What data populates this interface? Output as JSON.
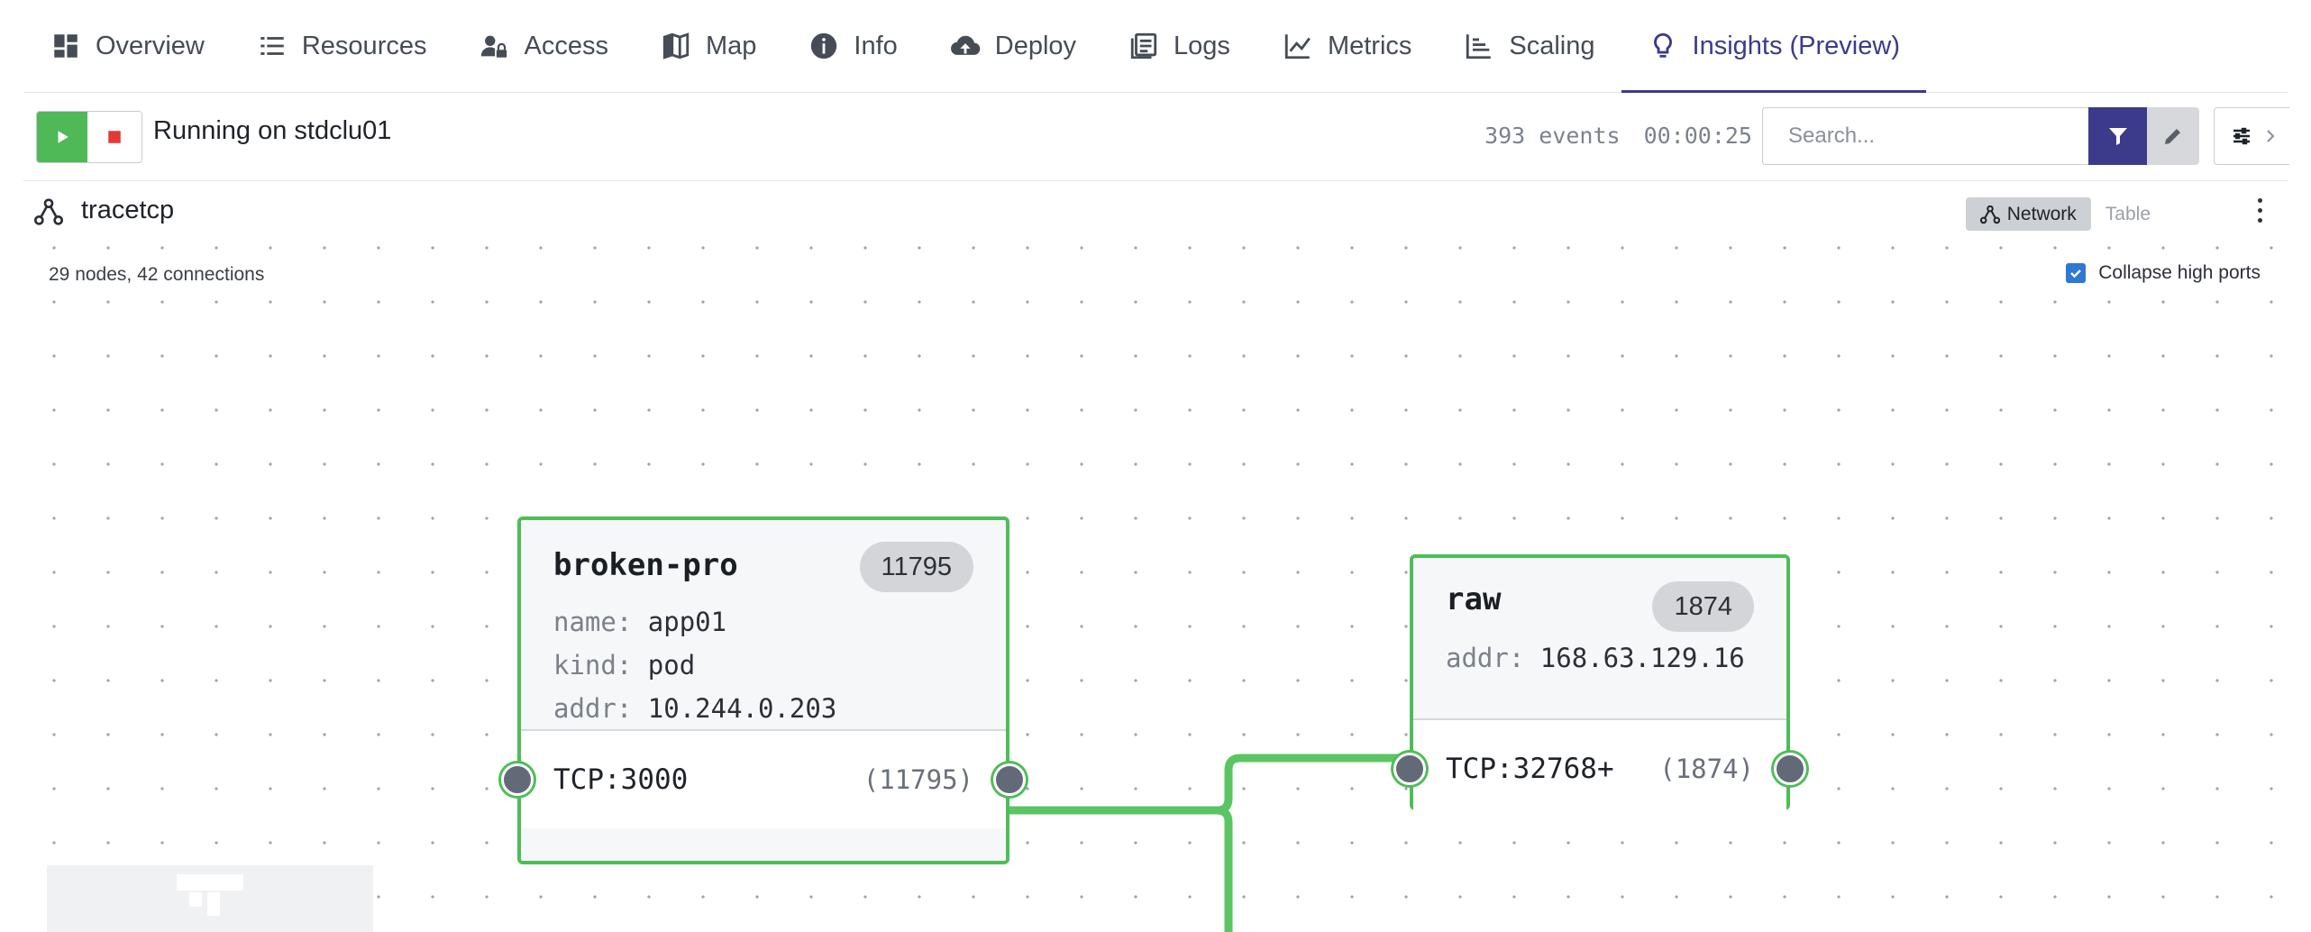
{
  "tabs": [
    {
      "label": "Overview",
      "icon": "dashboard-icon"
    },
    {
      "label": "Resources",
      "icon": "list-icon"
    },
    {
      "label": "Access",
      "icon": "user-lock-icon"
    },
    {
      "label": "Map",
      "icon": "map-icon"
    },
    {
      "label": "Info",
      "icon": "info-icon"
    },
    {
      "label": "Deploy",
      "icon": "cloud-upload-icon"
    },
    {
      "label": "Logs",
      "icon": "logs-icon"
    },
    {
      "label": "Metrics",
      "icon": "line-chart-icon"
    },
    {
      "label": "Scaling",
      "icon": "scaling-icon"
    },
    {
      "label": "Insights (Preview)",
      "icon": "lightbulb-icon",
      "active": true
    }
  ],
  "toolbar": {
    "status": "Running on stdclu01",
    "events": "393 events",
    "elapsed": "00:00:25",
    "search_placeholder": "Search..."
  },
  "panel": {
    "title": "tracetcp",
    "view_network": "Network",
    "view_table": "Table",
    "active_view": "Network"
  },
  "graph": {
    "stats": "29 nodes, 42 connections",
    "collapse_label": "Collapse high ports",
    "collapse_checked": true,
    "nodes": [
      {
        "name": "broken-pro",
        "count": "11795",
        "fields": [
          {
            "key": "name:",
            "value": "app01"
          },
          {
            "key": "kind:",
            "value": "pod"
          },
          {
            "key": "addr:",
            "value": "10.244.0.203"
          }
        ],
        "port": "TCP:3000",
        "port_count": "(11795)"
      },
      {
        "name": "raw",
        "count": "1874",
        "fields": [
          {
            "key": "addr:",
            "value": "168.63.129.16"
          }
        ],
        "port": "TCP:32768+",
        "port_count": "(1874)"
      }
    ]
  },
  "colors": {
    "accent": "#3c3a8a",
    "edge": "#5cc563",
    "node_border": "#4fbd57",
    "play": "#4fb857",
    "stop": "#e53935",
    "checkbox": "#2f78d3"
  }
}
